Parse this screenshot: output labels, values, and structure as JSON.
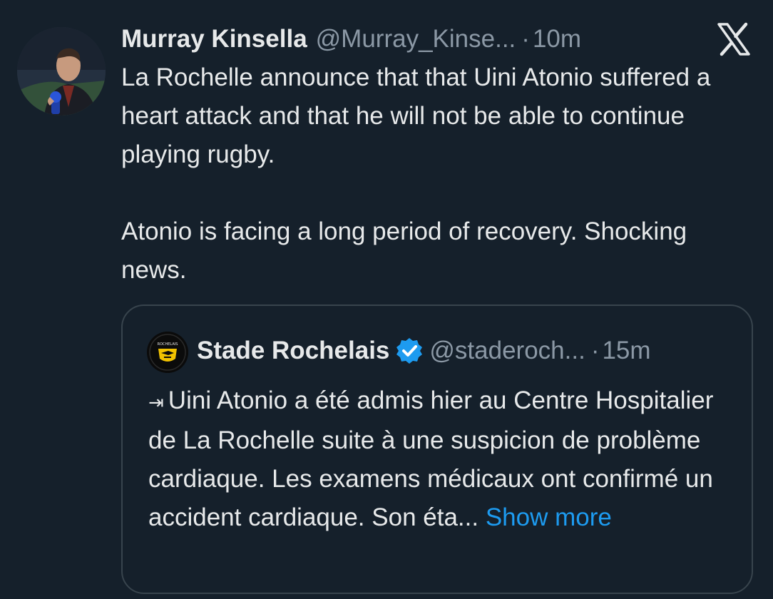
{
  "tweet": {
    "author_name": "Murray Kinsella",
    "author_handle": "@Murray_Kinse...",
    "separator": "·",
    "time": "10m",
    "paragraphs": [
      "La Rochelle announce that that Uini Atonio suffered a heart attack and that he will not be able to continue playing rugby.",
      "Atonio is facing a long period of recovery. Shocking news."
    ]
  },
  "quote": {
    "author_name": "Stade Rochelais",
    "author_handle": "@staderoch...",
    "separator": "·",
    "time": "15m",
    "arrow": "⇥",
    "text": "Uini Atonio a été admis hier au Centre Hospitalier de La Rochelle suite à une suspicion de problème cardiaque. Les examens médicaux ont confirmé un accident cardiaque. Son éta...",
    "show_more": "Show more",
    "logo_text": "ROCHELAIS"
  },
  "icons": {
    "brand": "x-logo-icon",
    "verified": "verified-badge-icon"
  },
  "colors": {
    "background": "#15202b",
    "text": "#e7e9ea",
    "secondary_text": "#8b98a5",
    "link": "#1d9bf0",
    "card_border": "#38444d",
    "logo_yellow": "#f2c200"
  }
}
